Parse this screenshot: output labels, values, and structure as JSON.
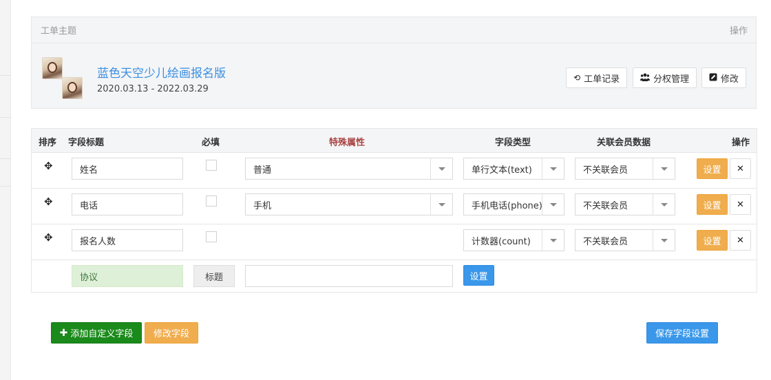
{
  "panel": {
    "header_left": "工单主题",
    "header_right": "操作",
    "title": "蓝色天空少儿绘画报名版",
    "date_range": "2020.03.13 - 2022.03.29",
    "buttons": {
      "records": "工单记录",
      "permissions": "分权管理",
      "edit": "修改"
    }
  },
  "table": {
    "headers": {
      "order": "排序",
      "field_title": "字段标题",
      "required": "必填",
      "special": "特殊属性",
      "field_type": "字段类型",
      "member_data": "关联会员数据",
      "action": "操作"
    },
    "special_color": "#a94442",
    "rows": [
      {
        "title": "姓名",
        "special": "普通",
        "type": "单行文本(text)",
        "member": "不关联会员",
        "set": "设置"
      },
      {
        "title": "电话",
        "special": "手机",
        "type": "手机电话(phone)",
        "member": "不关联会员",
        "set": "设置"
      },
      {
        "title": "报名人数",
        "type": "计数器(count)",
        "member": "不关联会员",
        "set": "设置"
      }
    ],
    "agreement": {
      "label": "协议",
      "title_button": "标题",
      "input_value": "",
      "set": "设置"
    }
  },
  "footer": {
    "add": "添加自定义字段",
    "modify": "修改字段",
    "save": "保存字段设置"
  },
  "icons": {
    "move": "move-icon",
    "history": "history-icon",
    "users": "users-icon",
    "edit": "edit-icon",
    "close": "close-icon",
    "plus": "plus-icon"
  },
  "colors": {
    "link_blue": "#3a8ee0",
    "primary": "#3a97ea",
    "warning": "#f0ad4e",
    "success": "#1a8a1a"
  }
}
